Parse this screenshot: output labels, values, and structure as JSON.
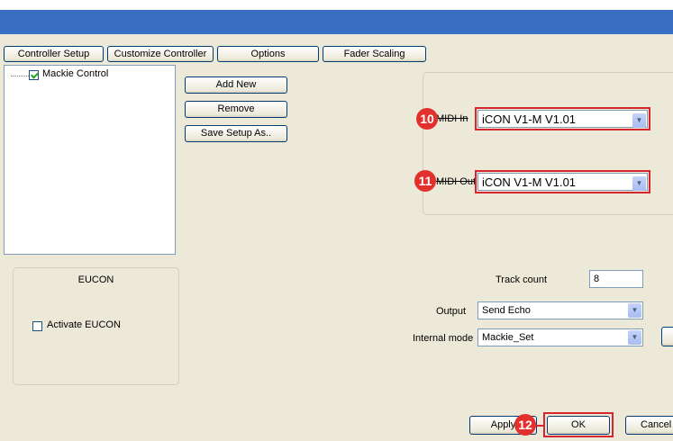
{
  "tabs": [
    "Controller Setup",
    "Customize Controller",
    "Options",
    "Fader Scaling"
  ],
  "tree": {
    "item_label": "Mackie Control",
    "item_checked": true
  },
  "buttons": {
    "add_new": "Add New",
    "remove": "Remove",
    "save_setup_as": "Save Setup As..",
    "apply": "Apply",
    "ok": "OK",
    "cancel": "Cancel"
  },
  "midi": {
    "in_label": "MIDI In",
    "in_value": "iCON V1-M V1.01",
    "out_label": "MIDI Out",
    "out_value": "iCON V1-M V1.01"
  },
  "callouts": {
    "midi_in": "10",
    "midi_out": "11",
    "ok": "12"
  },
  "eucon": {
    "title": "EUCON",
    "activate_label": "Activate EUCON",
    "activate_checked": false
  },
  "settings": {
    "track_count_label": "Track count",
    "track_count_value": "8",
    "output_label": "Output",
    "output_value": "Send Echo",
    "internal_mode_label": "Internal mode",
    "internal_mode_value": "Mackie_Set"
  },
  "colors": {
    "window_bg": "#ece9d8",
    "titlebar": "#3a6ec2",
    "highlight": "#d6262e"
  }
}
